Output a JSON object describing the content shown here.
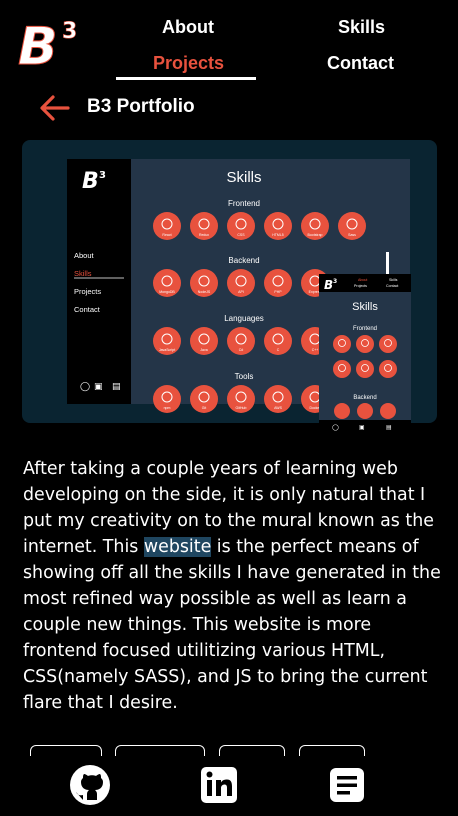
{
  "brand": {
    "logo_text": "B3"
  },
  "nav": {
    "about": "About",
    "skills": "Skills",
    "projects": "Projects",
    "contact": "Contact"
  },
  "header": {
    "title": "B3 Portfolio"
  },
  "preview": {
    "sidebar_items": [
      "About",
      "Skills",
      "Projects",
      "Contact"
    ],
    "heading": "Skills",
    "sections": [
      "Frontend",
      "Backend",
      "Languages",
      "Tools"
    ],
    "frontend": [
      "React",
      "Redux",
      "CSS",
      "HTML5",
      "Bootstrap",
      "Sass"
    ],
    "backend": [
      "MongoDB",
      "NodeJS",
      "API",
      "PHP",
      "Express"
    ],
    "languages": [
      "JavaScript",
      "Java",
      "C#",
      "C",
      "C++"
    ],
    "tools": [
      "npm",
      "Git",
      "GitHub",
      "AWS",
      "Docker"
    ],
    "mobile": {
      "nav": [
        "About",
        "Skills",
        "Projects",
        "Contact"
      ],
      "heading": "Skills",
      "sections": [
        "Frontend",
        "Backend"
      ]
    }
  },
  "description": {
    "before": "After taking a couple years of learning web developing on the side, it is only natural that I put my creativity on to the mural known as the internet. This ",
    "highlight": "website",
    "after": " is the perfect means of showing off all the skills I have generated in the most refined way possible as well as learn a couple new things. This website is more frontend focused utilitizing various HTML, CSS(namely SASS), and JS to bring the current flare that I desire."
  },
  "footer": {
    "icons": [
      "github-icon",
      "linkedin-icon",
      "resume-icon"
    ]
  },
  "colors": {
    "accent": "#e8523e",
    "panel": "#0a2431",
    "background": "#000000"
  }
}
